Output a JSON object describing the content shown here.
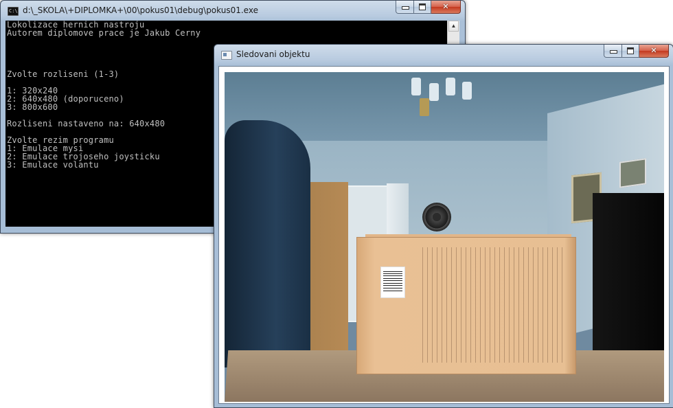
{
  "console_window": {
    "title": "d:\\_SKOLA\\+DIPLOMKA+\\00\\pokus01\\debug\\pokus01.exe",
    "lines": [
      "Lokolizace hernich nastroju",
      "Autorem diplomove prace je Jakub Cerny",
      "",
      "",
      "",
      "",
      "Zvolte rozliseni (1-3)",
      "",
      "1: 320x240",
      "2: 640x480 (doporuceno)",
      "3: 800x600",
      "",
      "Rozliseni nastaveno na: 640x480",
      "",
      "Zvolte rezim programu",
      "1: Emulace mysi",
      "2: Emulace trojoseho joysticku",
      "3: Emulace volantu"
    ],
    "icon": "console-icon"
  },
  "video_window": {
    "title": "Sledovani objektu",
    "icon": "window-icon",
    "content": "webcam-feed"
  },
  "caption_buttons": {
    "minimize_icon": "minimize-icon",
    "maximize_icon": "maximize-icon",
    "close_glyph": "✕"
  }
}
